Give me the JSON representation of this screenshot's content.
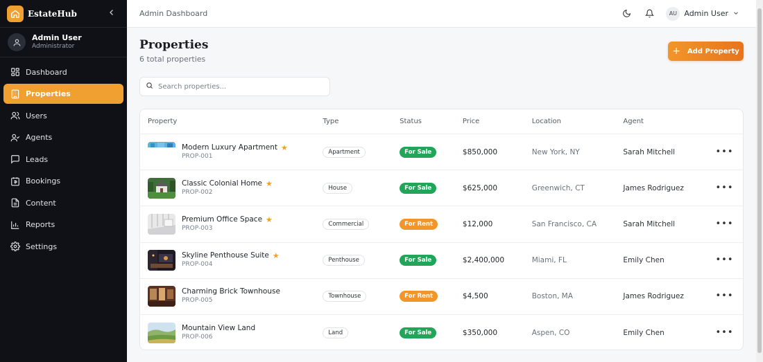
{
  "brand": {
    "name": "EstateHub"
  },
  "sidebar": {
    "user": {
      "name": "Admin User",
      "role": "Administrator"
    },
    "items": [
      {
        "label": "Dashboard",
        "icon": "dashboard-icon"
      },
      {
        "label": "Properties",
        "icon": "building-icon",
        "active": true
      },
      {
        "label": "Users",
        "icon": "users-icon"
      },
      {
        "label": "Agents",
        "icon": "agent-icon"
      },
      {
        "label": "Leads",
        "icon": "message-icon"
      },
      {
        "label": "Bookings",
        "icon": "calendar-icon"
      },
      {
        "label": "Content",
        "icon": "document-icon"
      },
      {
        "label": "Reports",
        "icon": "chart-icon"
      },
      {
        "label": "Settings",
        "icon": "gear-icon"
      }
    ]
  },
  "topbar": {
    "breadcrumb": "Admin Dashboard",
    "user_initials": "AU",
    "user_name": "Admin User"
  },
  "header": {
    "title": "Properties",
    "subtitle": "6 total properties",
    "add_label": "Add Property"
  },
  "search": {
    "placeholder": "Search properties..."
  },
  "table": {
    "columns": [
      "Property",
      "Type",
      "Status",
      "Price",
      "Location",
      "Agent"
    ],
    "rows": [
      {
        "name": "Modern Luxury Apartment",
        "id": "PROP-001",
        "featured": true,
        "type": "Apartment",
        "status": "For Sale",
        "price": "$850,000",
        "location": "New York, NY",
        "agent": "Sarah Mitchell"
      },
      {
        "name": "Classic Colonial Home",
        "id": "PROP-002",
        "featured": true,
        "type": "House",
        "status": "For Sale",
        "price": "$625,000",
        "location": "Greenwich, CT",
        "agent": "James Rodriguez"
      },
      {
        "name": "Premium Office Space",
        "id": "PROP-003",
        "featured": true,
        "type": "Commercial",
        "status": "For Rent",
        "price": "$12,000",
        "location": "San Francisco, CA",
        "agent": "Sarah Mitchell"
      },
      {
        "name": "Skyline Penthouse Suite",
        "id": "PROP-004",
        "featured": true,
        "type": "Penthouse",
        "status": "For Sale",
        "price": "$2,400,000",
        "location": "Miami, FL",
        "agent": "Emily Chen"
      },
      {
        "name": "Charming Brick Townhouse",
        "id": "PROP-005",
        "featured": false,
        "type": "Townhouse",
        "status": "For Rent",
        "price": "$4,500",
        "location": "Boston, MA",
        "agent": "James Rodriguez"
      },
      {
        "name": "Mountain View Land",
        "id": "PROP-006",
        "featured": false,
        "type": "Land",
        "status": "For Sale",
        "price": "$350,000",
        "location": "Aspen, CO",
        "agent": "Emily Chen"
      }
    ]
  },
  "colors": {
    "accent": "#f0a030",
    "for_sale": "#22a559",
    "for_rent": "#f0962a",
    "sidebar_bg": "#0f1117"
  }
}
